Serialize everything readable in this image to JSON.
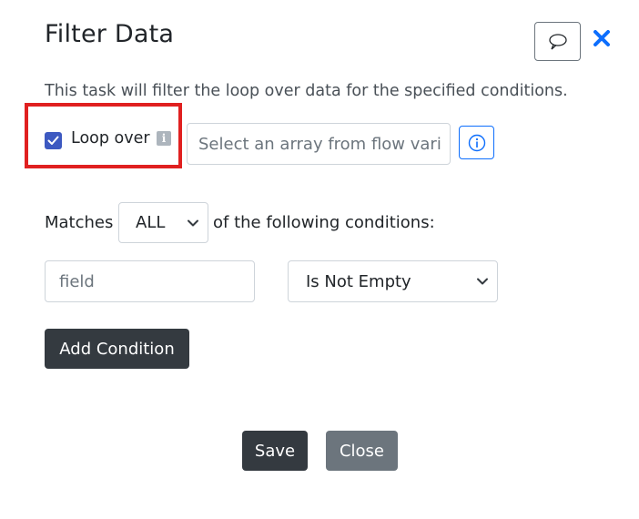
{
  "dialog": {
    "title": "Filter Data",
    "description": "This task will filter the loop over data for the specified conditions."
  },
  "loop_over": {
    "label": "Loop over",
    "checked": true,
    "info_badge": "i",
    "array_placeholder": "Select an array from flow vari"
  },
  "matches": {
    "prefix": "Matches",
    "selected": "ALL",
    "suffix": "of the following conditions:"
  },
  "condition": {
    "field_placeholder": "field",
    "operator": "Is Not Empty"
  },
  "buttons": {
    "add_condition": "Add Condition",
    "save": "Save",
    "close": "Close"
  },
  "icons": {
    "comment": "comment-icon",
    "close": "close-icon",
    "info": "info-icon",
    "checkbox": "checkmark-icon",
    "chevron": "chevron-down-icon"
  },
  "colors": {
    "accent": "#0d6efd",
    "checkbox": "#3d59c1",
    "highlight": "#e02020",
    "dark_button": "#343a40",
    "secondary_button": "#6c757d"
  }
}
